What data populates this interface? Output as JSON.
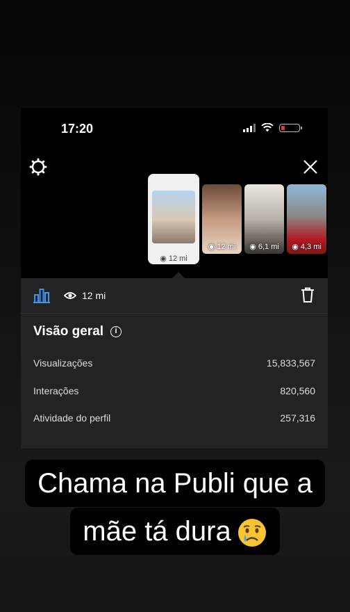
{
  "status_bar": {
    "time": "17:20"
  },
  "stories": [
    {
      "views": "12 mi"
    },
    {
      "views": "12 mi"
    },
    {
      "views": "6,1 mi"
    },
    {
      "views": "4,3 mi"
    }
  ],
  "panel": {
    "views": "12 mi",
    "overview_title": "Visão geral",
    "info_symbol": "i",
    "metrics": [
      {
        "label": "Visualizações",
        "value": "15,833,567"
      },
      {
        "label": "Interações",
        "value": "820,560"
      },
      {
        "label": "Atividade do perfil",
        "value": "257,316"
      }
    ]
  },
  "caption": {
    "line1": "Chama na Publi que a",
    "line2": "mãe tá dura"
  },
  "icons": {
    "settings": "settings-icon",
    "close": "close-icon",
    "chart": "bar-chart-icon",
    "eye": "eye-icon",
    "trash": "trash-icon",
    "emoji": "crying-face-emoji"
  },
  "colors": {
    "accent": "#3897f0",
    "battery_low": "#e53935",
    "panel_bg": "#232325"
  }
}
